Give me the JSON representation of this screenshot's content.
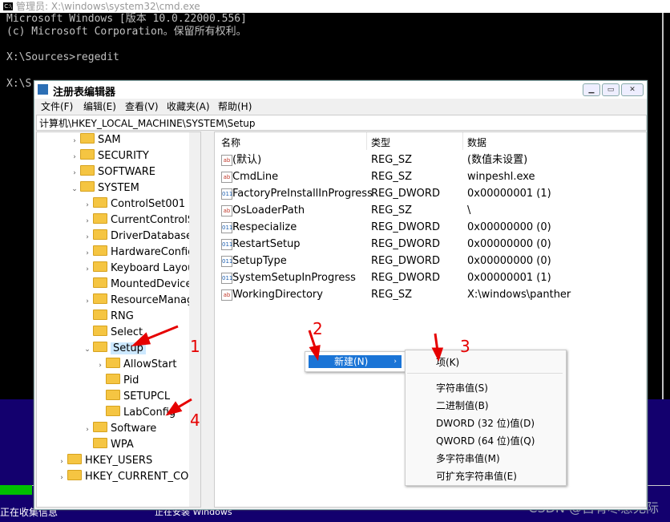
{
  "cmd": {
    "title": "管理员: X:\\windows\\system32\\cmd.exe",
    "icon_text": "C:\\",
    "lines": "Microsoft Windows [版本 10.0.22000.556]\n(c) Microsoft Corporation。保留所有权利。\n\nX:\\Sources>regedit",
    "line2": "X:\\S"
  },
  "background": {
    "status_left": "正在收集信息",
    "status_right": "正在安装 Windows",
    "watermark": "CSDN @自有尽意无际"
  },
  "regedit": {
    "title": "注册表编辑器",
    "menu": [
      "文件(F)",
      "编辑(E)",
      "查看(V)",
      "收藏夹(A)",
      "帮助(H)"
    ],
    "address": "计算机\\HKEY_LOCAL_MACHINE\\SYSTEM\\Setup",
    "tree": [
      {
        "label": "SAM",
        "arrow": "›"
      },
      {
        "label": "SECURITY",
        "arrow": "›"
      },
      {
        "label": "SOFTWARE",
        "arrow": "›"
      },
      {
        "label": "SYSTEM",
        "arrow": "⌄"
      },
      {
        "label": "ControlSet001",
        "arrow": "›"
      },
      {
        "label": "CurrentControlSet",
        "arrow": "›"
      },
      {
        "label": "DriverDatabase",
        "arrow": "›"
      },
      {
        "label": "HardwareConfig",
        "arrow": "›"
      },
      {
        "label": "Keyboard Layout",
        "arrow": "›"
      },
      {
        "label": "MountedDevices",
        "arrow": ""
      },
      {
        "label": "ResourceManager",
        "arrow": "›"
      },
      {
        "label": "RNG",
        "arrow": ""
      },
      {
        "label": "Select",
        "arrow": ""
      },
      {
        "label": "Setup",
        "arrow": "⌄",
        "selected": true
      },
      {
        "label": "AllowStart",
        "arrow": "›"
      },
      {
        "label": "Pid",
        "arrow": ""
      },
      {
        "label": "SETUPCL",
        "arrow": ""
      },
      {
        "label": "LabConfig",
        "arrow": ""
      },
      {
        "label": "Software",
        "arrow": "›"
      },
      {
        "label": "WPA",
        "arrow": ""
      },
      {
        "label": "HKEY_USERS",
        "arrow": "›"
      },
      {
        "label": "HKEY_CURRENT_CONFIG",
        "arrow": "›"
      }
    ],
    "columns": {
      "name": "名称",
      "type": "类型",
      "data": "数据"
    },
    "values": [
      {
        "name": "(默认)",
        "type": "REG_SZ",
        "data": "(数值未设置)",
        "icon": "sz"
      },
      {
        "name": "CmdLine",
        "type": "REG_SZ",
        "data": "winpeshl.exe",
        "icon": "sz"
      },
      {
        "name": "FactoryPreInstallInProgress",
        "type": "REG_DWORD",
        "data": "0x00000001 (1)",
        "icon": "dw"
      },
      {
        "name": "OsLoaderPath",
        "type": "REG_SZ",
        "data": "\\",
        "icon": "sz"
      },
      {
        "name": "Respecialize",
        "type": "REG_DWORD",
        "data": "0x00000000 (0)",
        "icon": "dw"
      },
      {
        "name": "RestartSetup",
        "type": "REG_DWORD",
        "data": "0x00000000 (0)",
        "icon": "dw"
      },
      {
        "name": "SetupType",
        "type": "REG_DWORD",
        "data": "0x00000000 (0)",
        "icon": "dw"
      },
      {
        "name": "SystemSetupInProgress",
        "type": "REG_DWORD",
        "data": "0x00000001 (1)",
        "icon": "dw"
      },
      {
        "name": "WorkingDirectory",
        "type": "REG_SZ",
        "data": "X:\\windows\\panther",
        "icon": "sz"
      }
    ],
    "icon_text": {
      "sz": "ab",
      "dw": "011"
    }
  },
  "context_menu": {
    "new_label": "新建(N)",
    "submenu_first": "项(K)",
    "submenu_items": [
      "字符串值(S)",
      "二进制值(B)",
      "DWORD (32 位)值(D)",
      "QWORD (64 位)值(Q)",
      "多字符串值(M)",
      "可扩充字符串值(E)"
    ]
  },
  "annotations": [
    "1",
    "2",
    "3",
    "4"
  ]
}
